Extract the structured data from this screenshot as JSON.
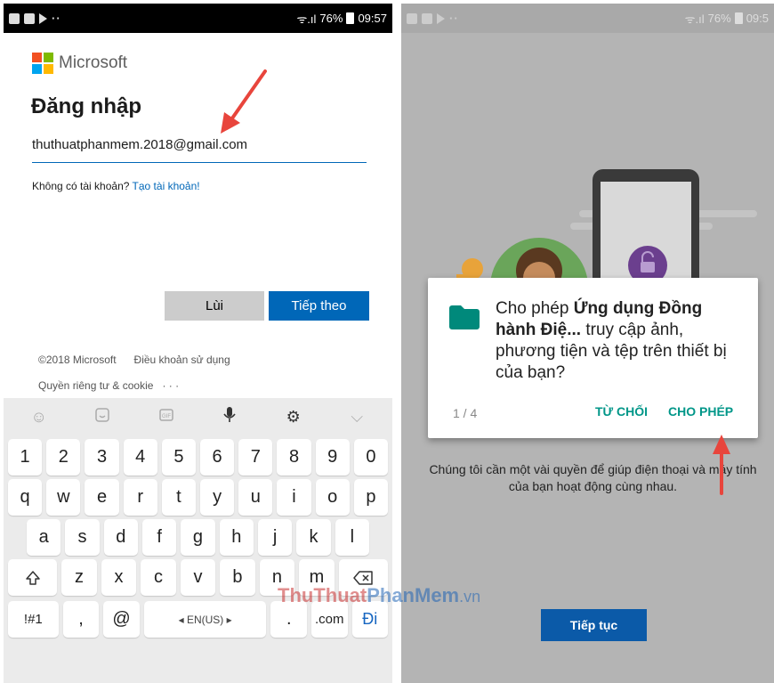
{
  "left": {
    "status": {
      "signal": "ᯤ.ıl",
      "battery": "76%",
      "time": "09:57"
    },
    "brand": "Microsoft",
    "title": "Đăng nhập",
    "email": "thuthuatphanmem.2018@gmail.com",
    "no_account_text": "Không có tài khoản? ",
    "create_account_link": "Tạo tài khoản!",
    "back_button": "Lùi",
    "next_button": "Tiếp theo",
    "footer": {
      "copyright": "©2018 Microsoft",
      "terms": "Điều khoản sử dụng",
      "privacy": "Quyền riêng tư & cookie",
      "more": "· · ·"
    },
    "keyboard": {
      "toolbar_icons": [
        "emoji-icon",
        "sticker-icon",
        "gif-icon",
        "microphone-icon",
        "settings-icon",
        "chevron-down-icon"
      ],
      "row_numbers": [
        "1",
        "2",
        "3",
        "4",
        "5",
        "6",
        "7",
        "8",
        "9",
        "0"
      ],
      "row1": [
        "q",
        "w",
        "e",
        "r",
        "t",
        "y",
        "u",
        "i",
        "o",
        "p"
      ],
      "row2": [
        "a",
        "s",
        "d",
        "f",
        "g",
        "h",
        "j",
        "k",
        "l"
      ],
      "row3": [
        "z",
        "x",
        "c",
        "v",
        "b",
        "n",
        "m"
      ],
      "sym_key": "!#1",
      "comma_key": ",",
      "at_key": "@",
      "space_key": "◂ EN(US) ▸",
      "period_key": ".",
      "com_key": ".com",
      "go_key": "Đi"
    }
  },
  "right": {
    "status": {
      "signal": "ᯤ.ıl",
      "battery": "76%",
      "time": "09:5"
    },
    "dialog": {
      "text_prefix": "Cho phép ",
      "app_name": "Ứng dụng Đồng hành Điệ...",
      "text_suffix": " truy cập ảnh, phương tiện và tệp trên thiết bị của bạn?",
      "pager": "1 / 4",
      "deny_button": "TỪ CHỐI",
      "allow_button": "CHO PHÉP"
    },
    "description": "Chúng tôi cần một vài quyền để giúp điện thoại và máy tính của bạn hoạt động cùng nhau.",
    "continue_button": "Tiếp tục"
  },
  "watermark": {
    "part1": "ThuThuat",
    "part2": "PhanMem",
    "part3": ".vn"
  },
  "colors": {
    "ms_blue": "#0067b8",
    "teal": "#009688",
    "arrow_red": "#e8453c",
    "continue_blue": "#0b5aa8"
  }
}
